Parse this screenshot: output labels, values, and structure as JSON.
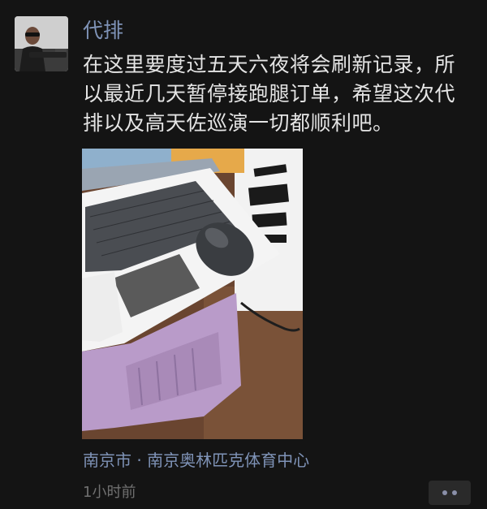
{
  "post": {
    "author": "代排",
    "text": "在这里要度过五天六夜将会刷新记录，所以最近几天暂停接跑腿订单，希望这次代排以及高天佐巡演一切都顺利吧。",
    "location": "南京市 · 南京奥林匹克体育中心",
    "time": "1小时前"
  },
  "icons": {
    "more": "more-dots-icon"
  },
  "colors": {
    "background": "#141414",
    "name_link": "#7f93b7",
    "body_text": "#e4e4e4",
    "timestamp": "#707070"
  }
}
